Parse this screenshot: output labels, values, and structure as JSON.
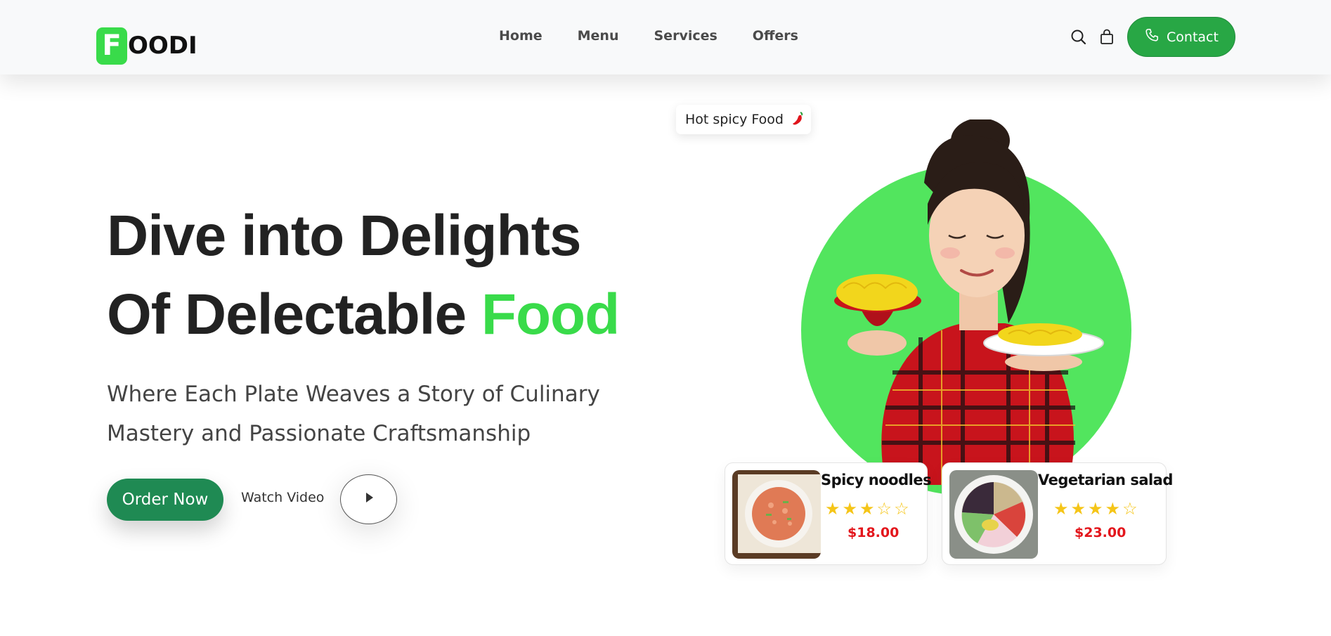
{
  "brand": {
    "logo_letter": "F",
    "logo_rest": "OODI",
    "accent": "#39db4a"
  },
  "nav": {
    "items": [
      {
        "label": "Home"
      },
      {
        "label": "Menu"
      },
      {
        "label": "Services"
      },
      {
        "label": "Offers"
      }
    ]
  },
  "header_actions": {
    "search_icon": "search-icon",
    "cart_icon": "shopping-bag-icon",
    "contact_label": "Contact",
    "contact_icon": "phone-icon"
  },
  "hero": {
    "headline_line1": "Dive into Delights",
    "headline_line2_prefix": "Of Delectable ",
    "headline_line2_highlight": "Food",
    "subline": "Where Each Plate Weaves a Story of Culinary Mastery and Passionate Craftsmanship",
    "order_button": "Order Now",
    "watch_label": "Watch Video",
    "play_icon": "play-icon"
  },
  "tag": {
    "label": "Hot spicy Food",
    "icon": "chili-pepper-icon"
  },
  "cards": [
    {
      "title": "Spicy noodles",
      "rating": 3,
      "max_rating": 5,
      "price": "$18.00",
      "image": "noodles-plate-photo"
    },
    {
      "title": "Vegetarian salad",
      "rating": 4,
      "max_rating": 5,
      "price": "$23.00",
      "image": "salad-bowl-photo"
    }
  ],
  "colors": {
    "green_button": "#28a745",
    "order_button": "#1f8a53",
    "price_red": "#e3161c",
    "star_yellow": "#f5c518",
    "circle_green": "#52e55e"
  }
}
